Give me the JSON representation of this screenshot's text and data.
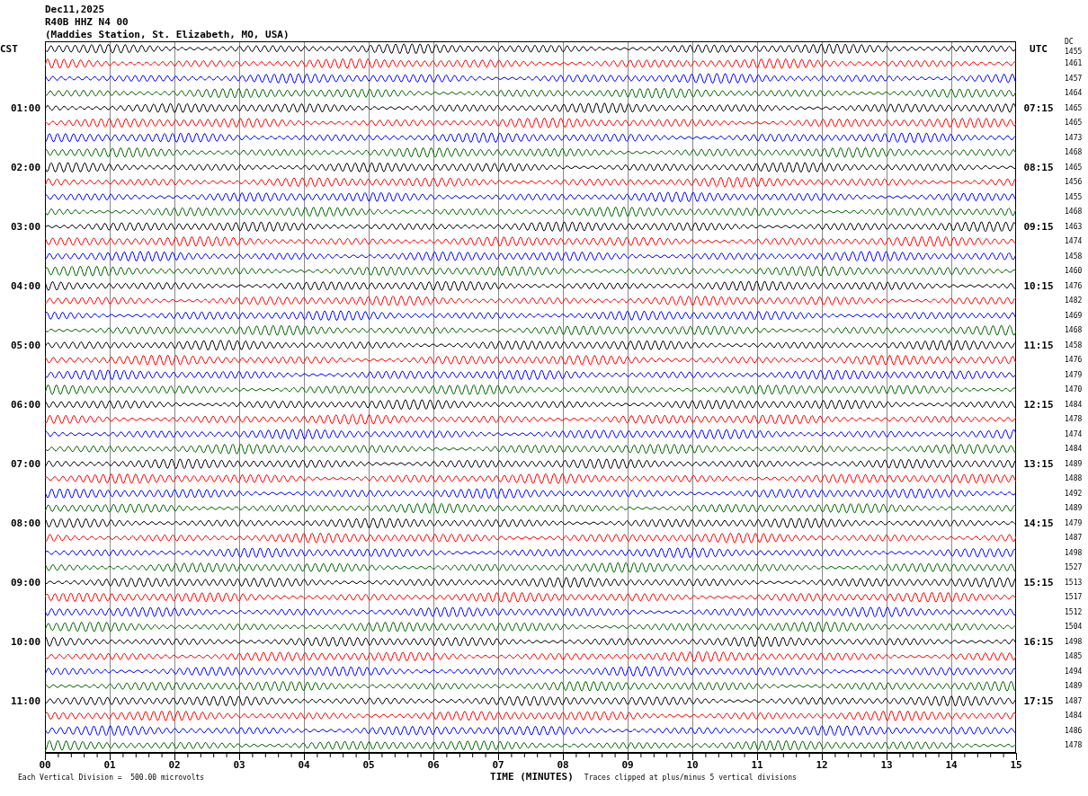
{
  "header": {
    "date": "Dec11,2025",
    "channel": "R40B HHZ N4 00",
    "station": "(Maddies Station, St. Elizabeth, MO, USA)"
  },
  "left_header": "CST",
  "right_header": "UTC",
  "dc_header": "DC",
  "traces": [
    {
      "color": "#000000",
      "dc": "1455"
    },
    {
      "color": "#ff0000",
      "dc": "1461"
    },
    {
      "color": "#0000ff",
      "dc": "1457"
    },
    {
      "color": "#006400",
      "dc": "1464"
    },
    {
      "color": "#000000",
      "dc": "1465",
      "cst": "01:00",
      "utc": "07:15"
    },
    {
      "color": "#ff0000",
      "dc": "1465"
    },
    {
      "color": "#0000ff",
      "dc": "1473"
    },
    {
      "color": "#006400",
      "dc": "1468"
    },
    {
      "color": "#000000",
      "dc": "1465",
      "cst": "02:00",
      "utc": "08:15"
    },
    {
      "color": "#ff0000",
      "dc": "1456"
    },
    {
      "color": "#0000ff",
      "dc": "1455"
    },
    {
      "color": "#006400",
      "dc": "1468"
    },
    {
      "color": "#000000",
      "dc": "1463",
      "cst": "03:00",
      "utc": "09:15"
    },
    {
      "color": "#ff0000",
      "dc": "1474"
    },
    {
      "color": "#0000ff",
      "dc": "1458"
    },
    {
      "color": "#006400",
      "dc": "1460"
    },
    {
      "color": "#000000",
      "dc": "1476",
      "cst": "04:00",
      "utc": "10:15"
    },
    {
      "color": "#ff0000",
      "dc": "1482"
    },
    {
      "color": "#0000ff",
      "dc": "1469"
    },
    {
      "color": "#006400",
      "dc": "1468"
    },
    {
      "color": "#000000",
      "dc": "1458",
      "cst": "05:00",
      "utc": "11:15"
    },
    {
      "color": "#ff0000",
      "dc": "1476"
    },
    {
      "color": "#0000ff",
      "dc": "1479"
    },
    {
      "color": "#006400",
      "dc": "1470"
    },
    {
      "color": "#000000",
      "dc": "1484",
      "cst": "06:00",
      "utc": "12:15"
    },
    {
      "color": "#ff0000",
      "dc": "1478"
    },
    {
      "color": "#0000ff",
      "dc": "1474"
    },
    {
      "color": "#006400",
      "dc": "1484"
    },
    {
      "color": "#000000",
      "dc": "1489",
      "cst": "07:00",
      "utc": "13:15"
    },
    {
      "color": "#ff0000",
      "dc": "1488"
    },
    {
      "color": "#0000ff",
      "dc": "1492"
    },
    {
      "color": "#006400",
      "dc": "1489"
    },
    {
      "color": "#000000",
      "dc": "1479",
      "cst": "08:00",
      "utc": "14:15"
    },
    {
      "color": "#ff0000",
      "dc": "1487"
    },
    {
      "color": "#0000ff",
      "dc": "1498"
    },
    {
      "color": "#006400",
      "dc": "1527"
    },
    {
      "color": "#000000",
      "dc": "1513",
      "cst": "09:00",
      "utc": "15:15"
    },
    {
      "color": "#ff0000",
      "dc": "1517"
    },
    {
      "color": "#0000ff",
      "dc": "1512"
    },
    {
      "color": "#006400",
      "dc": "1504"
    },
    {
      "color": "#000000",
      "dc": "1498",
      "cst": "10:00",
      "utc": "16:15"
    },
    {
      "color": "#ff0000",
      "dc": "1485"
    },
    {
      "color": "#0000ff",
      "dc": "1494"
    },
    {
      "color": "#006400",
      "dc": "1489"
    },
    {
      "color": "#000000",
      "dc": "1487",
      "cst": "11:00",
      "utc": "17:15"
    },
    {
      "color": "#ff0000",
      "dc": "1484"
    },
    {
      "color": "#0000ff",
      "dc": "1486"
    },
    {
      "color": "#006400",
      "dc": "1478"
    }
  ],
  "x_labels": [
    "00",
    "01",
    "02",
    "03",
    "04",
    "05",
    "06",
    "07",
    "08",
    "09",
    "10",
    "11",
    "12",
    "13",
    "14",
    "15"
  ],
  "footer": {
    "scale": "Each Vertical Division =  500.00 microvolts",
    "axis_title": "TIME (MINUTES)",
    "note": "Traces clipped at plus/minus 5 vertical divisions"
  }
}
